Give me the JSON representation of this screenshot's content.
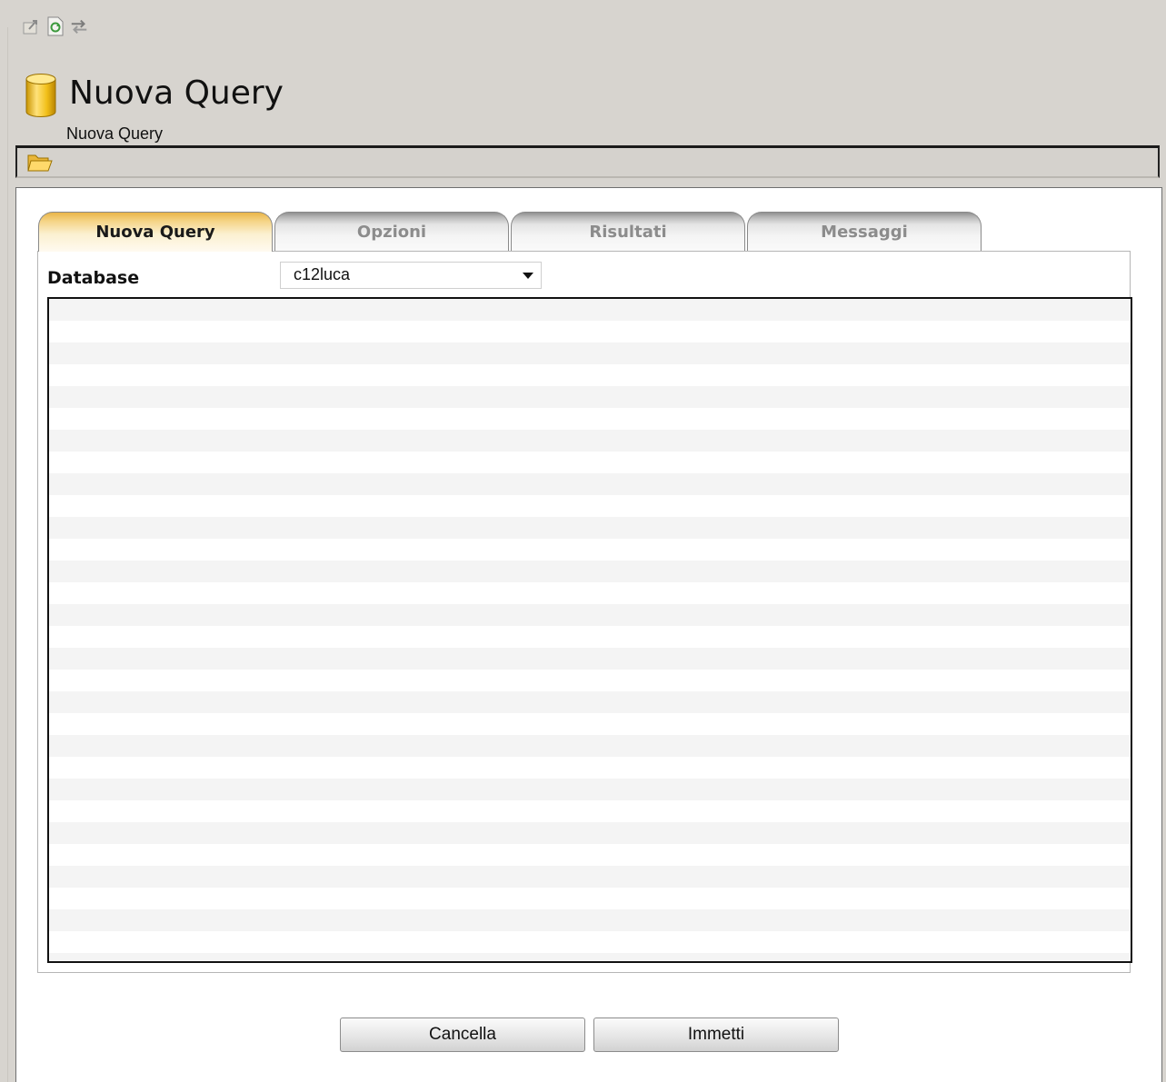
{
  "toolbar": {
    "icons": [
      "export-icon",
      "refresh-icon",
      "transfer-icon"
    ]
  },
  "header": {
    "title": "Nuova Query",
    "breadcrumb": "Nuova Query",
    "icon": "database-icon"
  },
  "actionbar": {
    "icons": [
      "open-folder-icon"
    ]
  },
  "tabs": [
    {
      "label": "Nuova Query",
      "active": true
    },
    {
      "label": "Opzioni",
      "active": false
    },
    {
      "label": "Risultati",
      "active": false
    },
    {
      "label": "Messaggi",
      "active": false
    }
  ],
  "form": {
    "database_label": "Database",
    "database_value": "c12luca",
    "query_text": ""
  },
  "buttons": {
    "cancel": "Cancella",
    "submit": "Immetti"
  },
  "colors": {
    "background": "#d7d4cf",
    "active_tab": "#f5d486",
    "panel": "#ffffff"
  }
}
